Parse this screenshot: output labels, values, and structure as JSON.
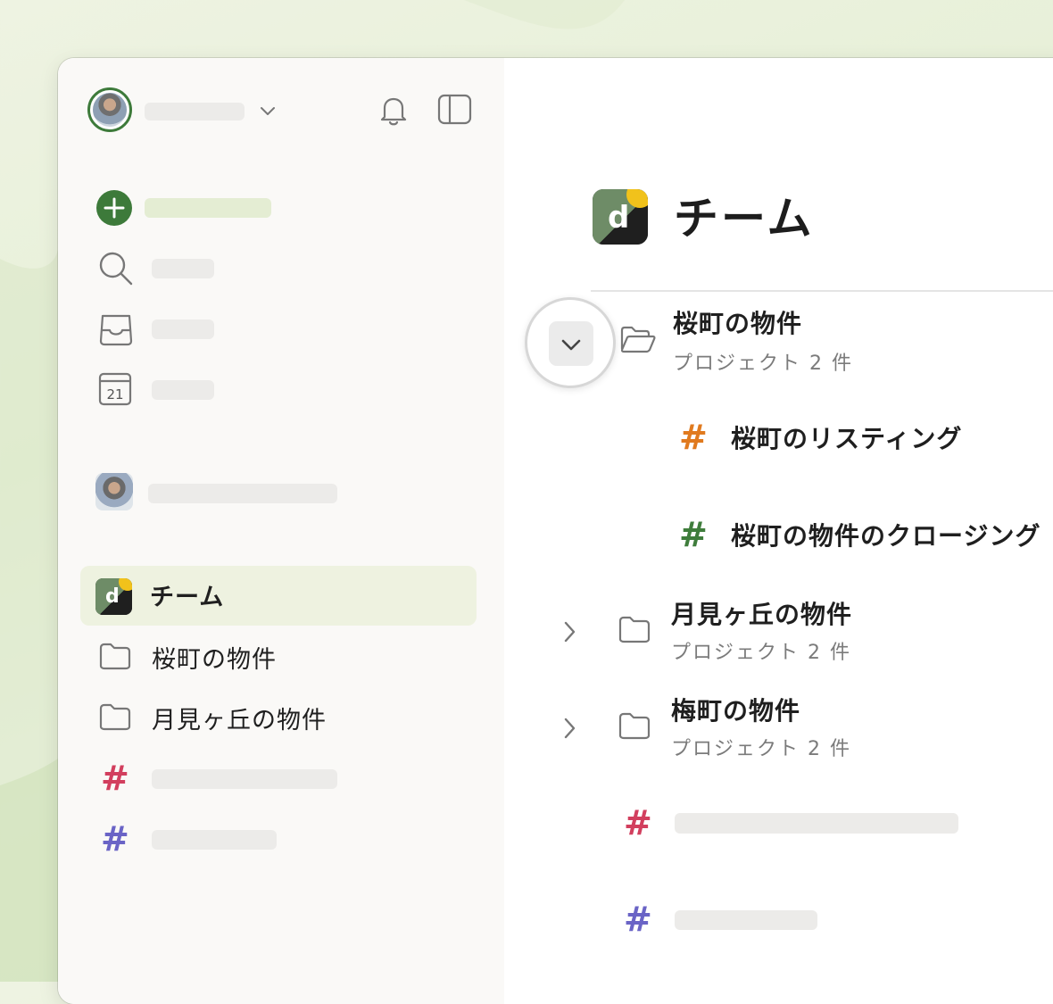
{
  "main": {
    "title": "チーム",
    "projects": [
      {
        "name": "桜町の物件",
        "subtitle": "プロジェクト 2 件",
        "expanded": true,
        "channels": [
          {
            "name": "桜町のリスティング",
            "color": "#e07a1f"
          },
          {
            "name": "桜町の物件のクロージング",
            "color": "#3f7d3c"
          }
        ]
      },
      {
        "name": "月見ヶ丘の物件",
        "subtitle": "プロジェクト 2 件",
        "expanded": false
      },
      {
        "name": "梅町の物件",
        "subtitle": "プロジェクト 2 件",
        "expanded": false
      }
    ],
    "hash_colors": [
      "#d23f5e",
      "#6a64c6"
    ]
  },
  "sidebar": {
    "team_label": "チーム",
    "folders": [
      "桜町の物件",
      "月見ヶ丘の物件"
    ],
    "hash_colors": [
      "#d23f5e",
      "#6a64c6"
    ],
    "calendar_day": "21",
    "add_color": "#3d7a3a"
  },
  "colors": {
    "accent": "#3d7a3a",
    "active_bg": "#eef2e0",
    "placeholder": "#ecebe9"
  }
}
